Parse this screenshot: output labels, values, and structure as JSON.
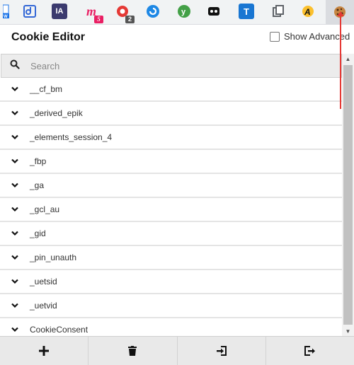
{
  "toolbar": {
    "extensions": [
      {
        "icon": "extension-w-icon",
        "text": "w",
        "color": "#1a73e8"
      },
      {
        "icon": "extension-link-icon",
        "text": "",
        "color": "#3367d6"
      },
      {
        "icon": "extension-ia-icon",
        "text": "IA",
        "color": "#3b3a6e"
      },
      {
        "icon": "extension-m-icon",
        "text": "m",
        "color": "#e91e63",
        "badge": "5"
      },
      {
        "icon": "extension-red-icon",
        "text": "",
        "color": "#e53935",
        "badge": "2"
      },
      {
        "icon": "extension-blue-circle-icon",
        "text": "",
        "color": "#1e88e5"
      },
      {
        "icon": "extension-green-y-icon",
        "text": "y",
        "color": "#43a047"
      },
      {
        "icon": "extension-black-icon",
        "text": "",
        "color": "#111111"
      },
      {
        "icon": "extension-t-icon",
        "text": "T",
        "color": "#1976d2"
      },
      {
        "icon": "extension-copy-icon",
        "text": "",
        "color": "#5f6368"
      },
      {
        "icon": "extension-a-icon",
        "text": "A",
        "color": "#fbc02d"
      },
      {
        "icon": "cookie-icon",
        "text": "",
        "color": "#a0522d"
      }
    ]
  },
  "header": {
    "title": "Cookie Editor",
    "advanced_label": "Show Advanced"
  },
  "search": {
    "placeholder": "Search",
    "value": ""
  },
  "cookies": [
    {
      "name": "__cf_bm"
    },
    {
      "name": "_derived_epik"
    },
    {
      "name": "_elements_session_4"
    },
    {
      "name": "_fbp"
    },
    {
      "name": "_ga"
    },
    {
      "name": "_gcl_au"
    },
    {
      "name": "_gid"
    },
    {
      "name": "_pin_unauth"
    },
    {
      "name": "_uetsid"
    },
    {
      "name": "_uetvid"
    },
    {
      "name": "CookieConsent"
    }
  ],
  "actions": [
    {
      "name": "add-cookie-button",
      "icon": "plus-icon"
    },
    {
      "name": "delete-all-button",
      "icon": "trash-icon"
    },
    {
      "name": "import-button",
      "icon": "import-icon"
    },
    {
      "name": "export-button",
      "icon": "export-icon"
    }
  ],
  "colors": {
    "indicator": "#e53935",
    "toolbar_bg": "#f1f3f4",
    "action_bar_bg": "#e9e9e9"
  }
}
